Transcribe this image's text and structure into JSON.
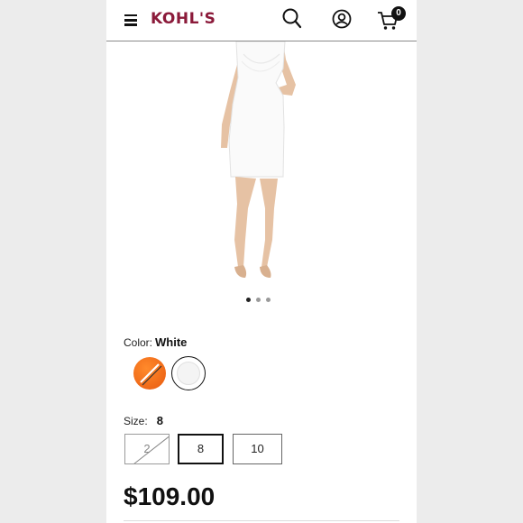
{
  "header": {
    "logo_text": "KOHL'S",
    "cart_count": "0",
    "brand_color": "#8b1a3a"
  },
  "icons": [
    "menu-icon",
    "search-icon",
    "account-icon",
    "cart-icon"
  ],
  "gallery": {
    "dot_count": 3,
    "active_index": 0
  },
  "color_selector": {
    "label": "Color:",
    "selected": "White",
    "swatches": [
      {
        "name": "orange-swatch",
        "color": "#f07020"
      },
      {
        "name": "white-swatch",
        "color": "#ffffff",
        "selected": true
      }
    ]
  },
  "size_selector": {
    "label": "Size:",
    "selected": "8",
    "options": [
      {
        "label": "2",
        "available": false
      },
      {
        "label": "8",
        "available": true,
        "selected": true
      },
      {
        "label": "10",
        "available": true
      }
    ]
  },
  "price": "$109.00"
}
